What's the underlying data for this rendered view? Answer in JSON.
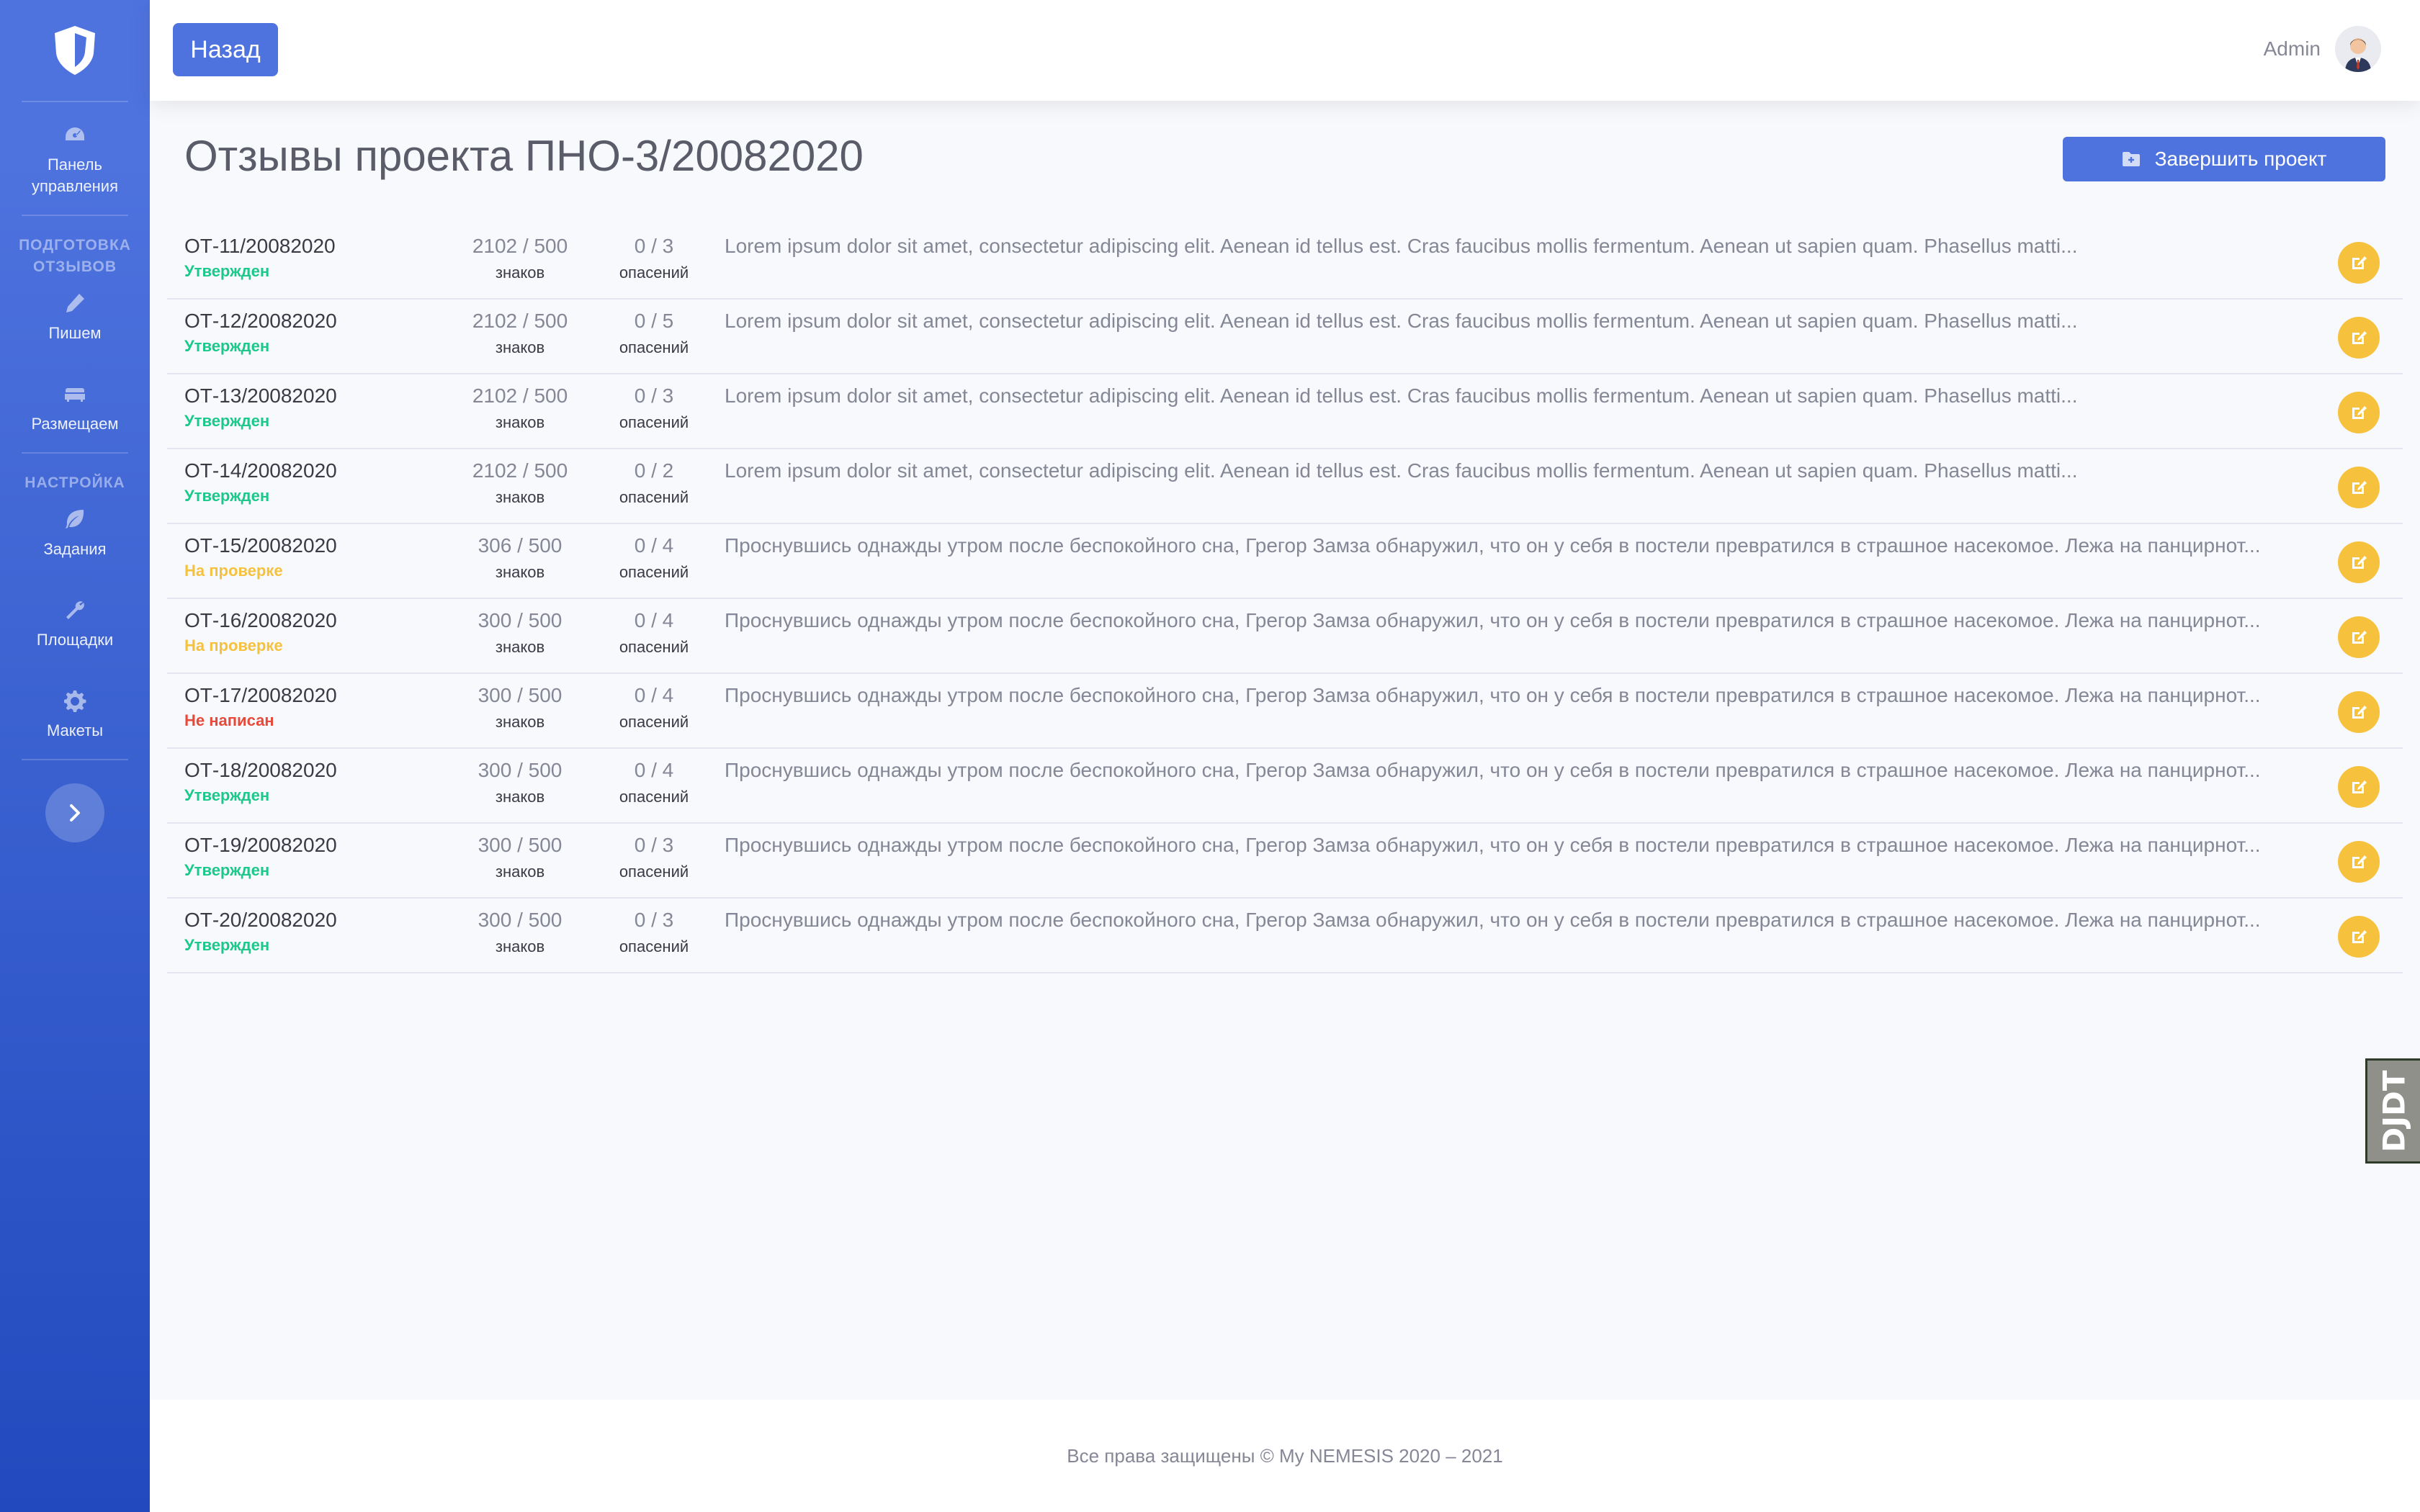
{
  "sidebar": {
    "items": [
      {
        "label": "Панель управления",
        "icon": "tachometer-icon"
      },
      {
        "label": "Пишем",
        "icon": "pencil-icon"
      },
      {
        "label": "Размещаем",
        "icon": "couch-icon"
      },
      {
        "label": "Задания",
        "icon": "leaf-icon"
      },
      {
        "label": "Площадки",
        "icon": "wrench-icon"
      },
      {
        "label": "Макеты",
        "icon": "gear-icon"
      }
    ],
    "headings": [
      "ПОДГОТОВКА ОТЗЫВОВ",
      "НАСТРОЙКА"
    ]
  },
  "topbar": {
    "back_label": "Назад",
    "user_name": "Admin"
  },
  "page": {
    "title": "Отзывы проекта ПНО-3/20082020",
    "finish_label": "Завершить проект"
  },
  "labels": {
    "chars": "знаков",
    "reviews": "опасений"
  },
  "rows": [
    {
      "code": "ОТ-11/20082020",
      "status": "Утвержден",
      "status_type": "ok",
      "chars": "2102 / 500",
      "reviews": "0 / 3",
      "text": "Lorem ipsum dolor sit amet, consectetur adipiscing elit. Aenean id tellus est. Cras faucibus mollis fermentum. Aenean ut sapien quam. Phasellus matti..."
    },
    {
      "code": "ОТ-12/20082020",
      "status": "Утвержден",
      "status_type": "ok",
      "chars": "2102 / 500",
      "reviews": "0 / 5",
      "text": "Lorem ipsum dolor sit amet, consectetur adipiscing elit. Aenean id tellus est. Cras faucibus mollis fermentum. Aenean ut sapien quam. Phasellus matti..."
    },
    {
      "code": "ОТ-13/20082020",
      "status": "Утвержден",
      "status_type": "ok",
      "chars": "2102 / 500",
      "reviews": "0 / 3",
      "text": "Lorem ipsum dolor sit amet, consectetur adipiscing elit. Aenean id tellus est. Cras faucibus mollis fermentum. Aenean ut sapien quam. Phasellus matti..."
    },
    {
      "code": "ОТ-14/20082020",
      "status": "Утвержден",
      "status_type": "ok",
      "chars": "2102 / 500",
      "reviews": "0 / 2",
      "text": "Lorem ipsum dolor sit amet, consectetur adipiscing elit. Aenean id tellus est. Cras faucibus mollis fermentum. Aenean ut sapien quam. Phasellus matti..."
    },
    {
      "code": "ОТ-15/20082020",
      "status": "На проверке",
      "status_type": "review",
      "chars": "306 / 500",
      "reviews": "0 / 4",
      "text": "Проснувшись однажды утром после беспокойного сна, Грегор Замза обнаружил, что он у себя в постели превратился в страшное насекомое. Лежа на панцирнот..."
    },
    {
      "code": "ОТ-16/20082020",
      "status": "На проверке",
      "status_type": "review",
      "chars": "300 / 500",
      "reviews": "0 / 4",
      "text": "Проснувшись однажды утром после беспокойного сна, Грегор Замза обнаружил, что он у себя в постели превратился в страшное насекомое. Лежа на панцирнот..."
    },
    {
      "code": "ОТ-17/20082020",
      "status": "Не написан",
      "status_type": "no",
      "chars": "300 / 500",
      "reviews": "0 / 4",
      "text": "Проснувшись однажды утром после беспокойного сна, Грегор Замза обнаружил, что он у себя в постели превратился в страшное насекомое. Лежа на панцирнот..."
    },
    {
      "code": "ОТ-18/20082020",
      "status": "Утвержден",
      "status_type": "ok",
      "chars": "300 / 500",
      "reviews": "0 / 4",
      "text": "Проснувшись однажды утром после беспокойного сна, Грегор Замза обнаружил, что он у себя в постели превратился в страшное насекомое. Лежа на панцирнот..."
    },
    {
      "code": "ОТ-19/20082020",
      "status": "Утвержден",
      "status_type": "ok",
      "chars": "300 / 500",
      "reviews": "0 / 3",
      "text": "Проснувшись однажды утром после беспокойного сна, Грегор Замза обнаружил, что он у себя в постели превратился в страшное насекомое. Лежа на панцирнот..."
    },
    {
      "code": "ОТ-20/20082020",
      "status": "Утвержден",
      "status_type": "ok",
      "chars": "300 / 500",
      "reviews": "0 / 3",
      "text": "Проснувшись однажды утром после беспокойного сна, Грегор Замза обнаружил, что он у себя в постели превратился в страшное насекомое. Лежа на панцирнот..."
    }
  ],
  "djdt_label": "DJDT",
  "footer": {
    "text": "Все права защищены © My NEMESIS 2020 – 2021"
  },
  "colors": {
    "primary": "#4e73df",
    "ok": "#1cc88a",
    "review": "#f6c23e",
    "no": "#e74a3b",
    "edit": "#f6c23e"
  }
}
